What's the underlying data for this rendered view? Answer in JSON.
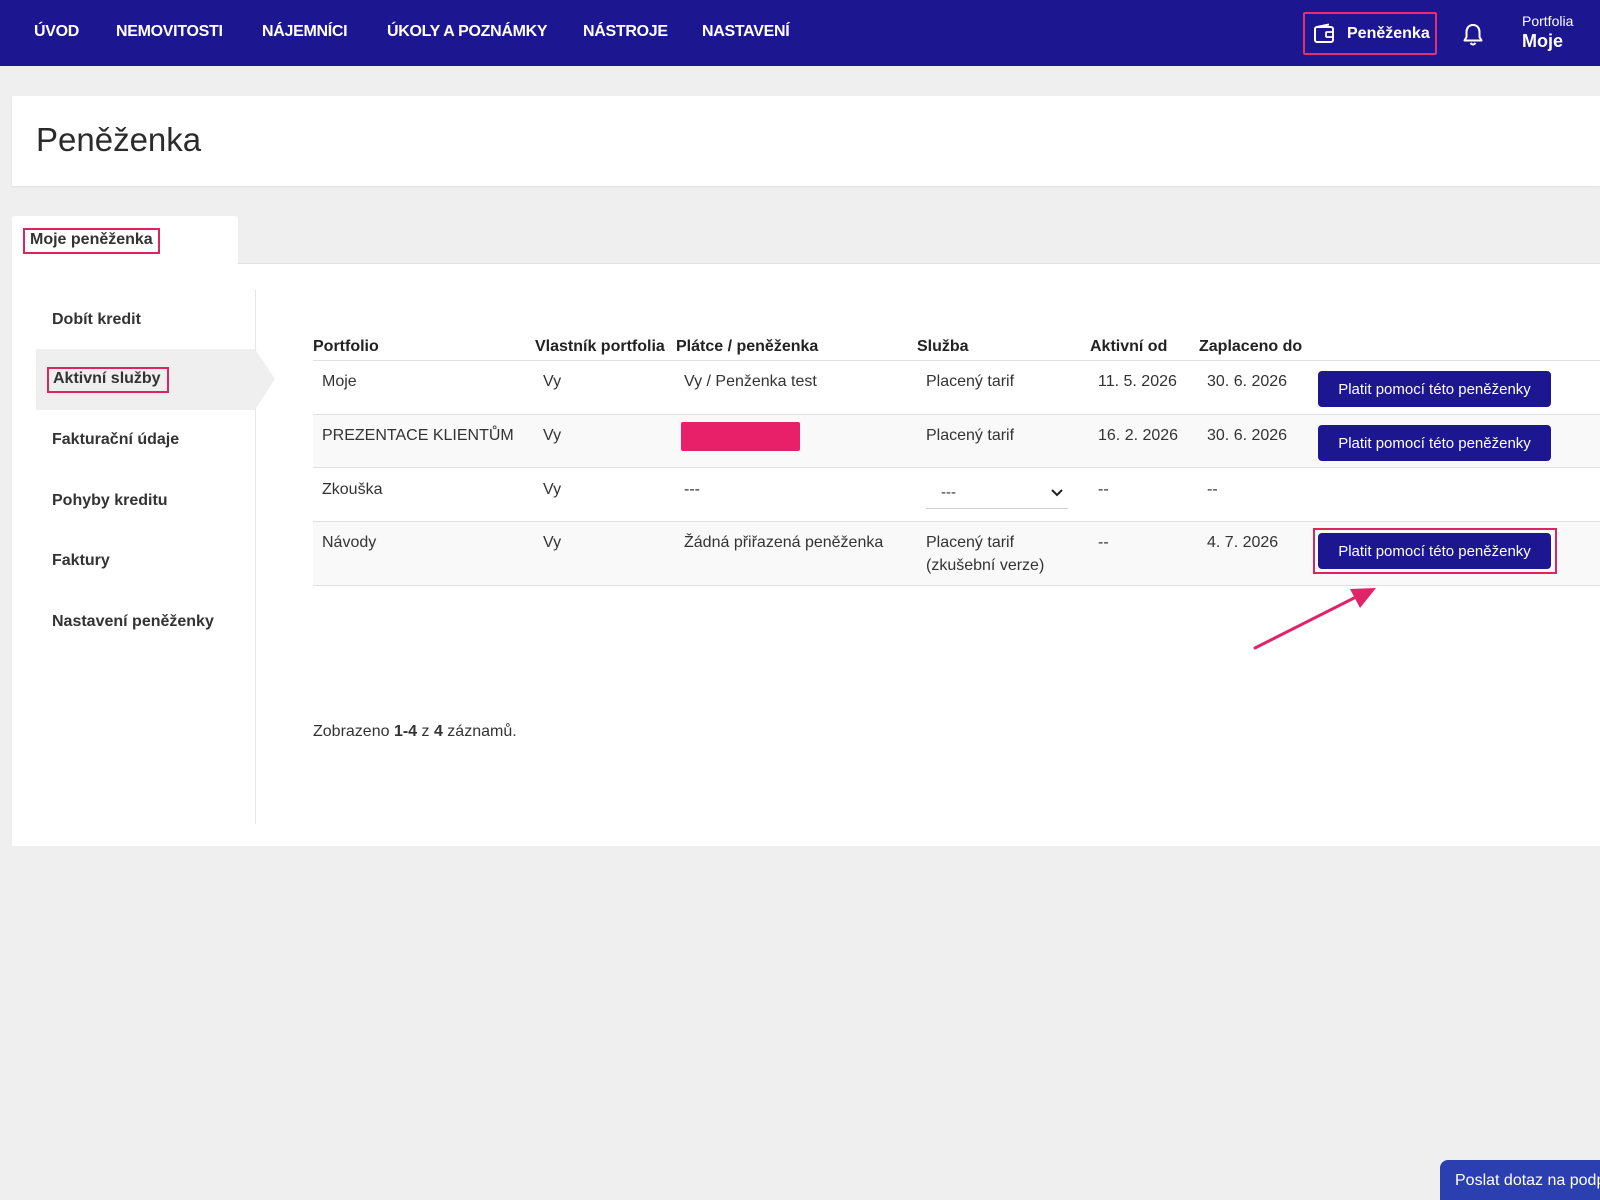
{
  "nav": {
    "items": [
      "ÚVOD",
      "NEMOVITOSTI",
      "NÁJEMNÍCI",
      "ÚKOLY A POZNÁMKY",
      "NÁSTROJE",
      "NASTAVENÍ"
    ],
    "wallet_label": "Peněženka",
    "wallet_icon": "wallet-icon",
    "bell_icon": "bell-icon",
    "portfolio_caption": "Portfolia",
    "portfolio_name": "Moje"
  },
  "page": {
    "title": "Peněženka"
  },
  "tabs": {
    "active_label": "Moje peněženka"
  },
  "sidebar": {
    "items": [
      {
        "label": "Dobít kredit"
      },
      {
        "label": "Aktivní služby"
      },
      {
        "label": "Fakturační údaje"
      },
      {
        "label": "Pohyby kreditu"
      },
      {
        "label": "Faktury"
      },
      {
        "label": "Nastavení peněženky"
      }
    ],
    "active_index": 1
  },
  "table": {
    "columns": [
      "Portfolio",
      "Vlastník portfolia",
      "Plátce / peněženka",
      "Služba",
      "Aktivní od",
      "Zaplaceno do"
    ],
    "rows": [
      {
        "portfolio": "Moje",
        "owner": "Vy",
        "payer": "Vy / Penženka test",
        "service": "Placený tarif",
        "service2": "",
        "active_from": "11. 5. 2026",
        "paid_to": "30. 6. 2026",
        "button": "Platit pomocí této peněženky"
      },
      {
        "portfolio": "PREZENTACE KLIENTŮM",
        "owner": "Vy",
        "payer": "",
        "service": "Placený tarif",
        "service2": "",
        "active_from": "16. 2. 2026",
        "paid_to": "30. 6. 2026",
        "button": "Platit pomocí této peněženky"
      },
      {
        "portfolio": "Zkouška",
        "owner": "Vy",
        "payer": "---",
        "service": "---",
        "service2": "",
        "active_from": "--",
        "paid_to": "--",
        "button": ""
      },
      {
        "portfolio": "Návody",
        "owner": "Vy",
        "payer": "Žádná přiřazená peněženka",
        "service": "Placený tarif",
        "service2": "(zkušební verze)",
        "active_from": "--",
        "paid_to": "4. 7. 2026",
        "button": "Platit pomocí této peněženky"
      }
    ]
  },
  "summary": {
    "prefix": "Zobrazeno ",
    "range": "1-4",
    "middle": " z ",
    "total": "4",
    "suffix": " záznamů."
  },
  "help": {
    "label": "Poslat dotaz na podporu"
  },
  "colors": {
    "navbar": "#1c1690",
    "primary_button": "#1c1690",
    "highlight": "#d9265f",
    "redaction": "#e8206a",
    "help_button": "#2b3fb1"
  }
}
